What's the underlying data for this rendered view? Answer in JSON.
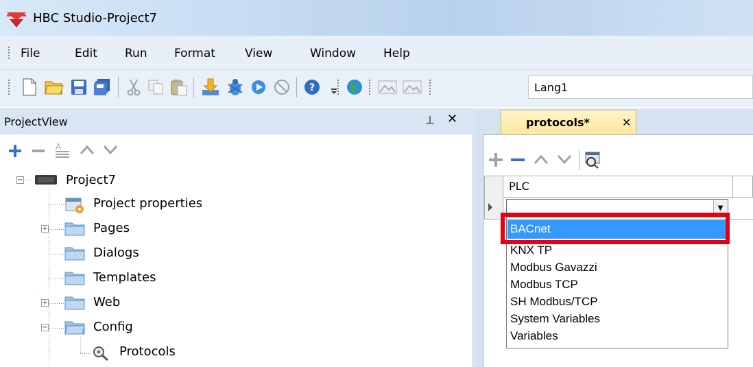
{
  "window": {
    "title": "HBC Studio-Project7"
  },
  "menu": [
    "File",
    "Edit",
    "Run",
    "Format",
    "View",
    "Window",
    "Help"
  ],
  "toolbar": {
    "language_value": "Lang1"
  },
  "project_view": {
    "title": "ProjectView",
    "pin_glyph": "⊥",
    "close_glyph": "✕",
    "tree": {
      "root": "Project7",
      "items": [
        "Project properties",
        "Pages",
        "Dialogs",
        "Templates",
        "Web",
        "Config",
        "Protocols"
      ]
    }
  },
  "editor": {
    "tab_label": "protocols*",
    "tab_close": "✕",
    "grid": {
      "column_header": "PLC",
      "combo_value": "",
      "options": [
        "BACnet",
        "KNX TP",
        "Modbus Gavazzi",
        "Modbus TCP",
        "SH Modbus/TCP",
        "System Variables",
        "Variables"
      ],
      "selected_option": "BACnet"
    }
  },
  "colors": {
    "selection": "#3399ff",
    "highlight_border": "#e60012",
    "tab_active": "#ffe9a0"
  }
}
